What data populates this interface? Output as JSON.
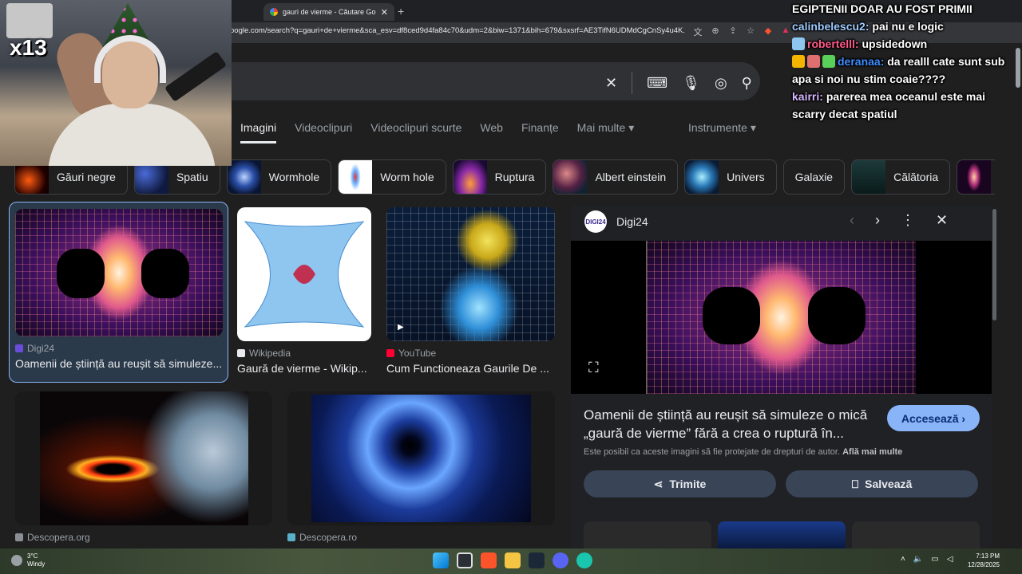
{
  "browser": {
    "tab_title": "gauri de vierme - Căutare Googl",
    "url": "oogle.com/search?q=gauri+de+vierme&sca_esv=df8ced9d4fa84c70&udm=2&biw=1371&bih=679&sxsrf=AE3TifN6UDMdCgCnSy4u4K..."
  },
  "nav": {
    "tabs": [
      "Imagini",
      "Videoclipuri",
      "Videoclipuri scurte",
      "Web",
      "Finanțe",
      "Mai multe"
    ],
    "tools": "Instrumente"
  },
  "chips": [
    "Găuri negre",
    "Spatiu",
    "Wormhole",
    "Worm hole",
    "Ruptura",
    "Albert einstein",
    "Univers",
    "Galaxie",
    "Călătoria"
  ],
  "results": [
    {
      "source": "Digi24",
      "title": "Oamenii de știință au reușit să simuleze..."
    },
    {
      "source": "Wikipedia",
      "title": "Gaură de vierme - Wikip..."
    },
    {
      "source": "YouTube",
      "title": "Cum Functioneaza Gaurile De ..."
    },
    {
      "source": "Descopera.org",
      "title": ""
    },
    {
      "source": "Descopera.ro",
      "title": ""
    }
  ],
  "panel": {
    "source": "Digi24",
    "logo_text": "DIGI24",
    "title": "Oamenii de știință au reușit să simuleze o mică „gaură de vierme” fără a crea o ruptură în...",
    "visit_label": "Accesează",
    "copyright": "Este posibil ca aceste imagini să fie protejate de drepturi de autor.",
    "learn_more": "Află mai multe",
    "share_label": "Trimite",
    "save_label": "Salvează"
  },
  "stream": {
    "multiplier": "x13",
    "chat": [
      {
        "user": "",
        "message": "EGIPTENII DOAR AU FOST PRIMII"
      },
      {
        "user": "calinbelescu2:",
        "message": "pai nu e logic"
      },
      {
        "user": "robertelll:",
        "message": "upsidedown"
      },
      {
        "user": "deranaa:",
        "message": "da realll cate sunt sub apa si noi nu stim coaie????"
      },
      {
        "user": "kairri:",
        "message": "parerea mea oceanul este mai scarry decat spatiul"
      }
    ]
  },
  "taskbar": {
    "temperature": "3°C",
    "weather": "Windy",
    "time": "7:13 PM",
    "date": "12/28/2025"
  },
  "colors": {
    "accent": "#8ab4f8",
    "page_bg": "#1f1f1f",
    "panel_bg": "#202124"
  }
}
